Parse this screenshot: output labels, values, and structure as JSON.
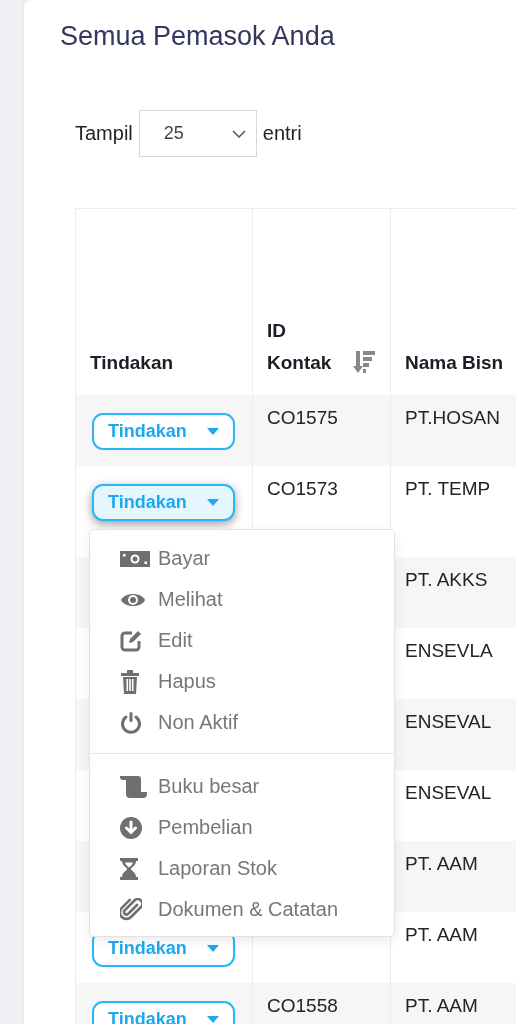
{
  "title": "Semua Pemasok Anda",
  "page_length": {
    "label": "Tampil",
    "value": "25",
    "suffix": "entri"
  },
  "table": {
    "columns": [
      {
        "label": "Tindakan",
        "sorted": false
      },
      {
        "label": "ID Kontak",
        "sorted": true
      },
      {
        "label": "Nama Bisn",
        "sorted": false
      }
    ],
    "rows": [
      {
        "action": "Tindakan",
        "expanded": false,
        "id": "CO1575",
        "name": "PT.HOSAN"
      },
      {
        "action": "Tindakan",
        "expanded": true,
        "id": "CO1573",
        "name": "PT. TEMP"
      },
      {
        "name": "PT. AKKS"
      },
      {
        "name": "ENSEVLA"
      },
      {
        "name": "ENSEVAL"
      },
      {
        "name": "ENSEVAL"
      },
      {
        "name": "PT. AAM"
      },
      {
        "action": "Tindakan",
        "expanded": false,
        "name": "PT. AAM"
      },
      {
        "action": "Tindakan",
        "expanded": false,
        "id": "CO1558",
        "name": "PT. AAM"
      }
    ]
  },
  "action_menu": {
    "sections": [
      [
        "Bayar",
        "Melihat",
        "Edit",
        "Hapus",
        "Non Aktif"
      ],
      [
        "Buku besar",
        "Pembelian",
        "Laporan Stok",
        "Dokumen & Catatan"
      ]
    ]
  }
}
